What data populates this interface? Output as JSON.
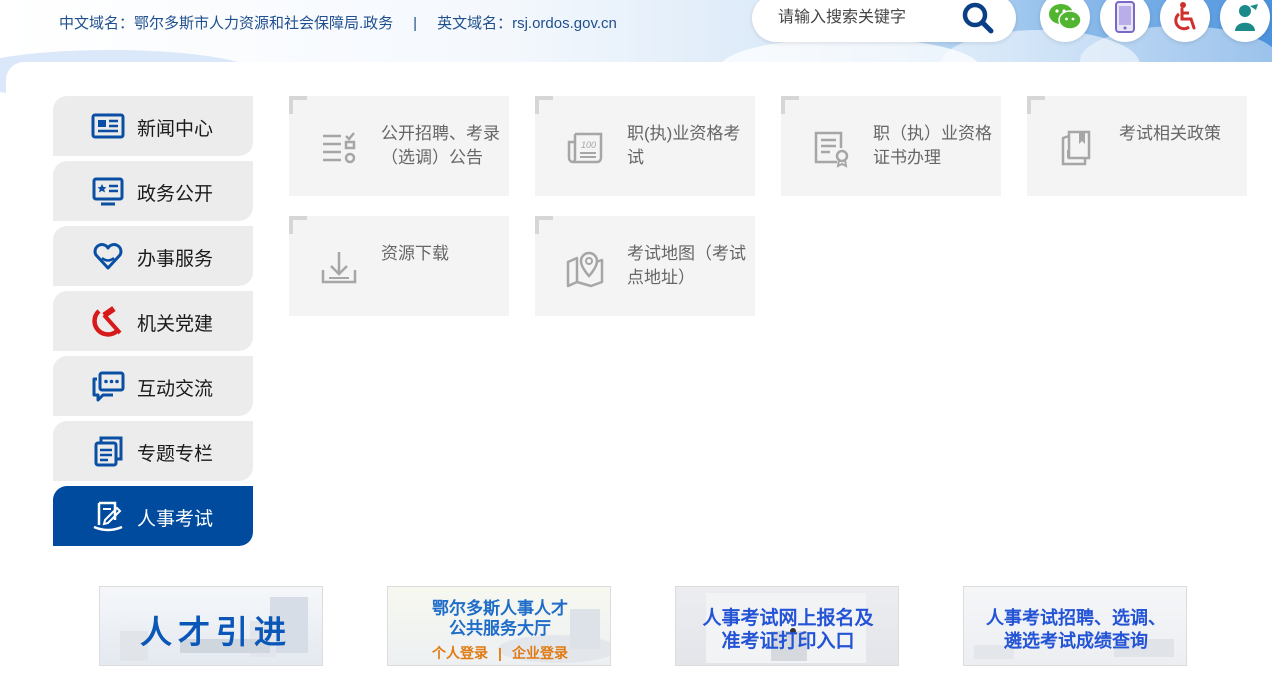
{
  "header": {
    "cn_domain": "中文域名：鄂尔多斯市人力资源和社会保障局.政务",
    "separator": "|",
    "en_domain": "英文域名：rsj.ordos.gov.cn",
    "search_placeholder": "请输入搜索关键字",
    "tools": [
      "wechat-icon",
      "mobile-icon",
      "accessibility-icon",
      "elderly-care-icon"
    ]
  },
  "sidebar": {
    "items": [
      {
        "label": "新闻中心",
        "icon": "news-icon"
      },
      {
        "label": "政务公开",
        "icon": "gov-open-icon"
      },
      {
        "label": "办事服务",
        "icon": "service-heart-icon"
      },
      {
        "label": "机关党建",
        "icon": "party-emblem-icon"
      },
      {
        "label": "互动交流",
        "icon": "chat-icon"
      },
      {
        "label": "专题专栏",
        "icon": "topic-icon"
      },
      {
        "label": "人事考试",
        "icon": "exam-icon",
        "active": true
      }
    ]
  },
  "cards": [
    {
      "label": "公开招聘、考录（选调）公告",
      "icon": "list-check-icon"
    },
    {
      "label": "职(执)业资格考试",
      "icon": "newspaper-icon"
    },
    {
      "label": "职（执）业资格证书办理",
      "icon": "certificate-icon"
    },
    {
      "label": "考试相关政策",
      "icon": "policy-book-icon"
    },
    {
      "label": "资源下载",
      "icon": "download-icon"
    },
    {
      "label": "考试地图（考试点地址）",
      "icon": "map-icon"
    }
  ],
  "banners": {
    "b1_title": "人才引进",
    "b2_line1": "鄂尔多斯人事人才",
    "b2_line2": "公共服务大厅",
    "b2_link1": "个人登录",
    "b2_sep": "|",
    "b2_link2": "企业登录",
    "b3_line1": "人事考试网上报名及",
    "b3_line2": "准考证打印入口",
    "b4_line1": "人事考试招聘、选调、",
    "b4_line2": "遴选考试成绩查询"
  },
  "colors": {
    "brand_blue": "#004b9e",
    "card_bg": "#f4f4f4",
    "sidebar_bg": "#ececec",
    "orange_link": "#e07a12"
  }
}
